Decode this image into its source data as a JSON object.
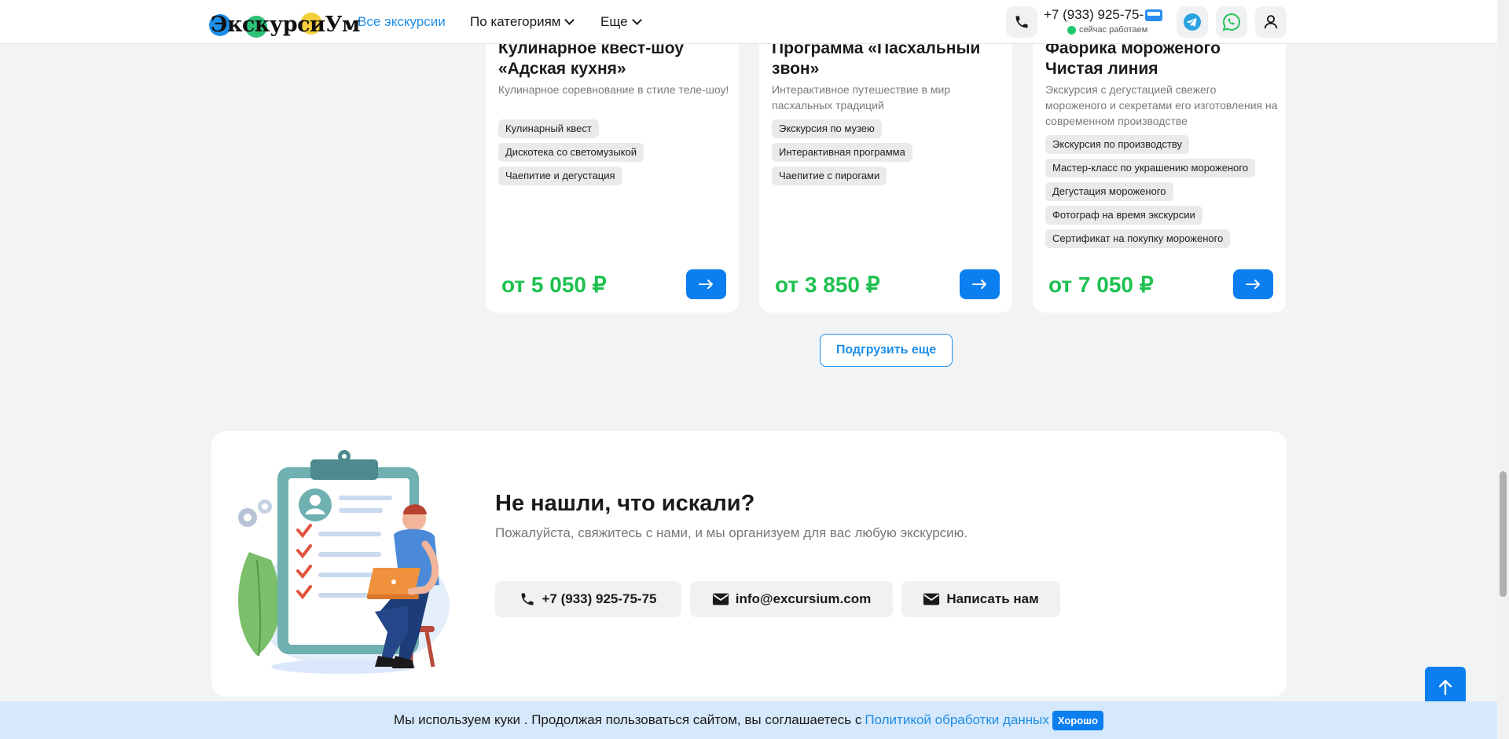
{
  "header": {
    "logo_text": "ЭкскурсиУм",
    "nav": {
      "all": "Все экскурсии",
      "categories": "По категориям",
      "more": "Еще"
    },
    "phone": "+7 (933) 925-75-",
    "status": "сейчас работаем"
  },
  "cards": [
    {
      "title": "Кулинарное квест-шоу «Адская кухня»",
      "desc": "Кулинарное соревнование в стиле теле-шоу!",
      "tags": [
        "Кулинарный квест",
        "Дискотека со светомузыкой",
        "Чаепитие и дегустация"
      ],
      "price": "от 5 050 ₽"
    },
    {
      "title": "Программа «Пасхальный звон»",
      "desc": "Интерактивное путешествие в мир пасхальных традиций",
      "tags": [
        "Экскурсия по музею",
        "Интерактивная программа",
        "Чаепитие с пирогами"
      ],
      "price": "от 3 850 ₽"
    },
    {
      "title": "Фабрика мороженого Чистая линия",
      "desc": "Экскурсия с дегустацией свежего мороженого и секретами его изготовления на современном производстве",
      "tags": [
        "Экскурсия по производству",
        "Мастер-класс по украшению мороженого",
        "Дегустация мороженого",
        "Фотограф на время экскурсии",
        "Сертификат на покупку мороженого"
      ],
      "price": "от 7 050 ₽"
    }
  ],
  "load_more": "Подгрузить еще",
  "contact": {
    "title": "Не нашли, что искали?",
    "subtitle": "Пожалуйста, свяжитесь с нами, и мы организуем для вас любую экскурсию.",
    "phone": "+7 (933) 925-75-75",
    "email": "info@excursium.com",
    "write": "Написать нам"
  },
  "cookie": {
    "text": "Мы используем куки . Продолжая пользоваться сайтом, вы соглашаетесь с",
    "link": "Политикой обработки данных",
    "ok": "Хорошо"
  },
  "colors": {
    "accent": "#0b7ef0",
    "link": "#1e8ee8",
    "price": "#1ec14f",
    "status": "#1ec86a"
  }
}
